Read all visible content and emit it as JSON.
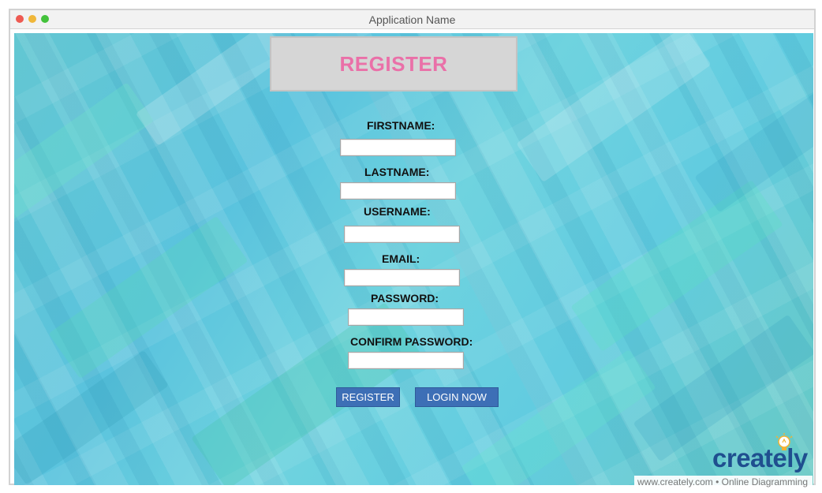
{
  "window": {
    "title": "Application Name"
  },
  "form": {
    "heading": "REGISTER",
    "fields": [
      {
        "label": "FIRSTNAME:",
        "value": ""
      },
      {
        "label": "LASTNAME:",
        "value": ""
      },
      {
        "label": "USERNAME:",
        "value": ""
      },
      {
        "label": "EMAIL:",
        "value": ""
      },
      {
        "label": "PASSWORD:",
        "value": ""
      },
      {
        "label": "CONFIRM PASSWORD:",
        "value": ""
      }
    ],
    "buttons": {
      "register": "REGISTER",
      "login": "LOGIN NOW"
    }
  },
  "branding": {
    "logo_text": "creately",
    "footer": "www.creately.com • Online Diagramming"
  },
  "colors": {
    "heading": "#ea70a8",
    "button": "#3d6fb6",
    "background_teal": "#5ac3de",
    "background_green": "#6fd3c4"
  }
}
